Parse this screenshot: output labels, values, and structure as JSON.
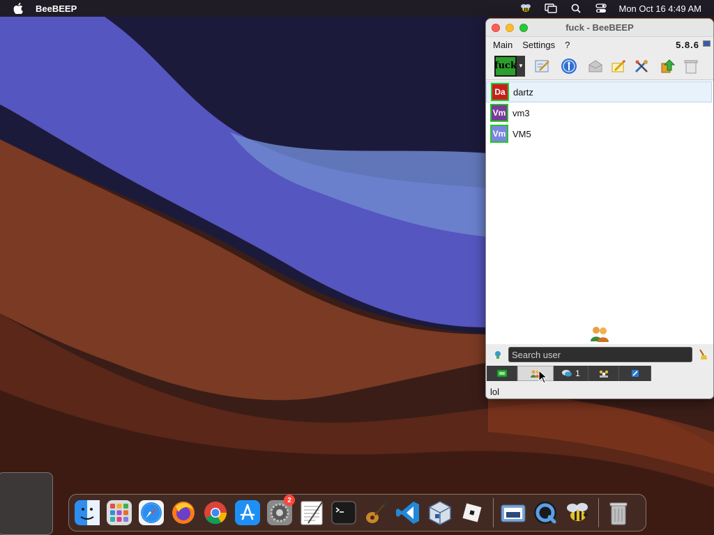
{
  "menubar": {
    "app_name": "BeeBEEP",
    "clock": "Mon Oct 16  4:49 AM"
  },
  "window": {
    "title": "fuck - BeeBEEP",
    "menu": [
      "Main",
      "Settings",
      "?"
    ],
    "version": "5.8.6",
    "status_label": "fuck"
  },
  "users": [
    {
      "initials": "Da",
      "name": "dartz",
      "color": "#c81e1e",
      "selected": true
    },
    {
      "initials": "Vm",
      "name": "vm3",
      "color": "#7a3a9a",
      "selected": false
    },
    {
      "initials": "Vm",
      "name": "VM5",
      "color": "#7a86e0",
      "selected": false
    }
  ],
  "search": {
    "placeholder": "Search user"
  },
  "tabs": {
    "chat_count": "1"
  },
  "status_text": "lol",
  "dock": {
    "apps": [
      "finder-icon",
      "launchpad-icon",
      "safari-icon",
      "firefox-icon",
      "chrome-icon",
      "app-store-icon",
      "system-settings-icon",
      "textedit-icon",
      "terminal-icon",
      "guitar-icon",
      "vscode-icon",
      "virtualbox-icon",
      "roblox-icon",
      "preview-icon",
      "quicktime-icon",
      "beebeep-icon",
      "trash-icon"
    ],
    "settings_badge": "2"
  },
  "colors": {
    "wallpaper_blue": "#5a5bc4",
    "wallpaper_brown": "#6a2f1e",
    "presence_green": "#22c922"
  }
}
